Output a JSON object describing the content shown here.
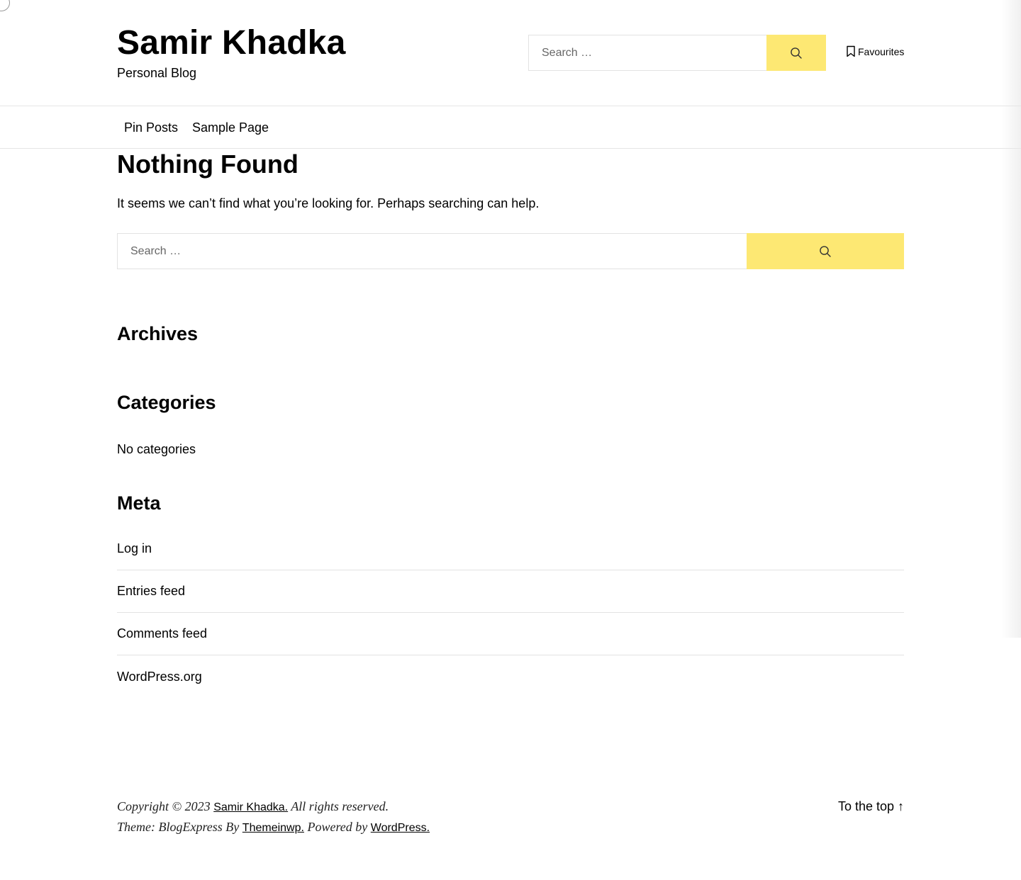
{
  "header": {
    "site_title": "Samir Khadka",
    "tagline": "Personal Blog",
    "search": {
      "placeholder": "Search …",
      "button_icon": "search-icon"
    },
    "favourites_label": "Favourites",
    "favourites_icon": "bookmark-icon"
  },
  "nav": {
    "items": [
      {
        "label": "Pin Posts"
      },
      {
        "label": "Sample Page"
      }
    ]
  },
  "main": {
    "title": "Nothing Found",
    "message": "It seems we can’t find what you’re looking for. Perhaps searching can help.",
    "search": {
      "placeholder": "Search …",
      "button_icon": "search-icon"
    }
  },
  "widgets": {
    "archives": {
      "title": "Archives"
    },
    "categories": {
      "title": "Categories",
      "empty_text": "No categories"
    },
    "meta": {
      "title": "Meta",
      "items": [
        {
          "label": "Log in"
        },
        {
          "label": "Entries feed"
        },
        {
          "label": "Comments feed"
        },
        {
          "label": "WordPress.org"
        }
      ]
    }
  },
  "footer": {
    "copyright_prefix": "Copyright © 2023",
    "copyright_link": "Samir Khadka.",
    "copyright_suffix": "All rights reserved.",
    "theme_prefix": "Theme: BlogExpress By",
    "theme_link": "Themeinwp.",
    "powered_prefix": "Powered by",
    "powered_link": "WordPress.",
    "to_top": "To the top ↑"
  },
  "colors": {
    "accent": "#fde873",
    "border": "#e2e2e2",
    "text": "#000000"
  }
}
